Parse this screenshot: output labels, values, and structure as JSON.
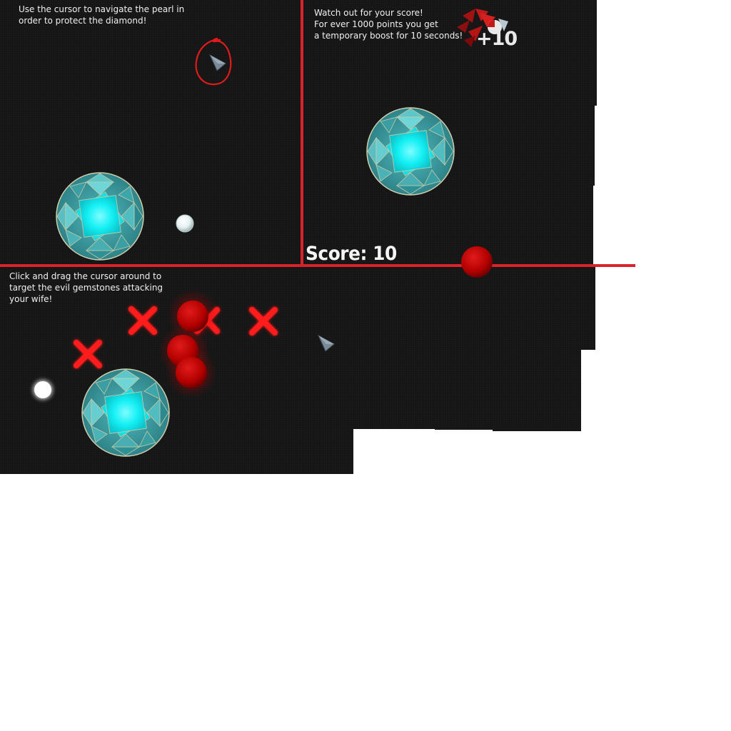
{
  "instructions": {
    "panel1": [
      "Use the cursor to navigate the pearl in",
      "order to protect the diamond!"
    ],
    "panel2": [
      "Watch out for your score!",
      "For ever 1000 points you get",
      "a temporary boost for 10 seconds!"
    ],
    "panel3": [
      "Click and drag the cursor around to",
      "target the evil gemstones attacking",
      "your wife!"
    ]
  },
  "hud": {
    "score_text": "Score: 10",
    "points_popup": "+10"
  },
  "colors": {
    "background": "#151515",
    "divider": "#d8232a",
    "diamond_core": "#12f2f5",
    "diamond_facet": "#2d8f93",
    "enemy": "#c00000",
    "pearl": "#ffffff"
  },
  "icons": {
    "cursor": "pointer-arrow-icon",
    "target_marker": "red-x-icon",
    "annotation": "red-circle-annotation"
  }
}
